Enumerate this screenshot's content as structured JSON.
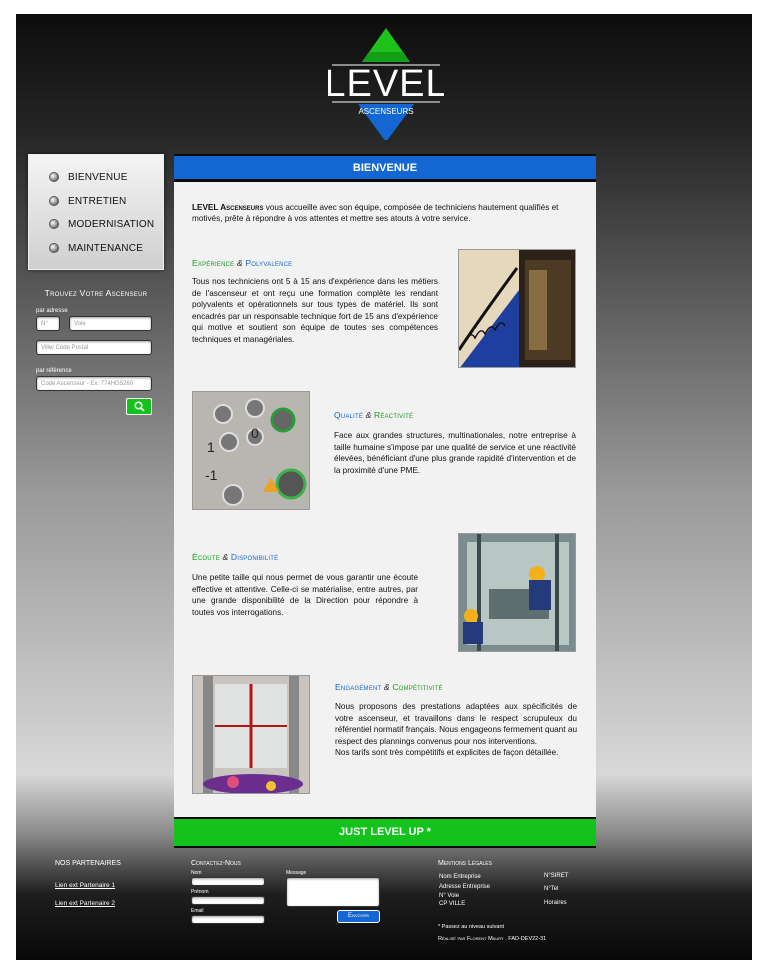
{
  "brand": {
    "name": "LEVEL",
    "tagline": "ASCENSEURS",
    "colors": {
      "blue": "#1467d2",
      "green": "#13c21b"
    }
  },
  "nav": {
    "items": [
      {
        "label": "BIENVENUE"
      },
      {
        "label": "ENTRETIEN"
      },
      {
        "label": "MODERNISATION"
      },
      {
        "label": "MAINTENANCE"
      }
    ]
  },
  "search": {
    "title": "Trouvez Votre Ascenseur",
    "by_address_label": "par adresse",
    "number_placeholder": "N°",
    "street_placeholder": "Voie",
    "city_placeholder": "Ville/ Code Postal",
    "by_reference_label": "par référence",
    "reference_placeholder": "Code Ascenseur - Ex: 774HG5260",
    "button_icon": "search-icon"
  },
  "main": {
    "header": "BIENVENUE",
    "intro_strong": "LEVEL Ascenseurs",
    "intro_rest": " vous accueille avec son équipe, composée de techniciens hautement qualifiés et motivés, prête à répondre à vos attentes et mettre ses atouts à votre service.",
    "sections": [
      {
        "title_a": "Expérience",
        "amp": "&",
        "title_b": "Polyvalence",
        "text": "Tous nos techniciens ont 5 à 15 ans d'expérience dans les métiers de l'ascenseur et ont reçu une formation complète les rendant polyvalents et opérationnels sur tous types de matériel. Ils sont encadrés par un responsable technique fort de 15 ans d'expérience qui motive et soutient son équipe de toutes ses compétences techniques et managériales."
      },
      {
        "title_a": "Qualité",
        "amp": "&",
        "title_b": "Réactivité",
        "text": "Face aux grandes structures, multinationales, notre entreprise à taille humaine s'impose par une qualité de service et une réactivité élevées, bénéficiant d'une plus grande rapidité d'intervention et de la proximité d'une PME."
      },
      {
        "title_a": "Écoute",
        "amp": "&",
        "title_b": "Disponibilité",
        "text": "Une petite taille qui nous permet de vous garantir une écoute effective et attentive. Celle-ci se matérialise, entre autres, par une grande disponibilité de la Direction pour répondre à toutes vos interrogations."
      },
      {
        "title_a": "Engagement",
        "amp": "&",
        "title_b": "Compétitivité",
        "text": "Nous proposons des prestations adaptées aux spécificités de votre ascenseur, et travaillons dans le respect scrupuleux du référentiel normatif français. Nous engageons fermement quant au respect des plannings convenus pour nos interventions.",
        "text2": "Nos tarifs sont très compétitifs et explicites de façon détaillée."
      }
    ],
    "footer": "JUST LEVEL UP *"
  },
  "footer": {
    "partners_title": "NOS PARTENAIRES",
    "partner_links": [
      "Lien ext Partenaire 1",
      "Lien ext Partenaire 2"
    ],
    "contact_title": "Contactez-Nous",
    "name_label": "Nom",
    "firstname_label": "Prénom",
    "email_label": "Email",
    "message_label": "Message",
    "send_label": "Envoyer",
    "legal_title": "Mentions Légales",
    "legal_company": "Nom Entreprise",
    "legal_address_1": "Adresse Entreprise",
    "legal_address_2": "N° Voie",
    "legal_address_3": "CP VILLE",
    "legal_siret": "N°SIRET",
    "legal_tel": "N°Tel",
    "legal_hours": "Horaires",
    "footnote": "* Passez au niveau suivant",
    "credit": "Réalisé par Florent Maury . FAD-DEV22-31"
  }
}
